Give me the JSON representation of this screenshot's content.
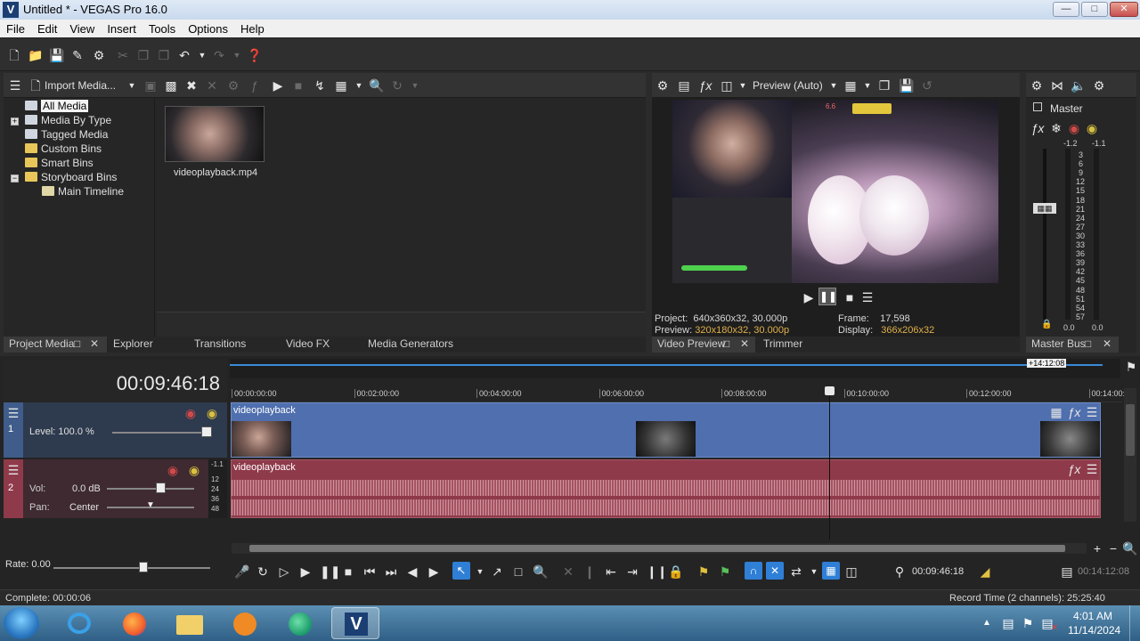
{
  "window": {
    "title": "Untitled * - VEGAS Pro 16.0",
    "app_icon_letter": "V"
  },
  "menu": [
    "File",
    "Edit",
    "View",
    "Insert",
    "Tools",
    "Options",
    "Help"
  ],
  "project_media": {
    "import_label": "Import Media...",
    "tree": [
      {
        "label": "All Media",
        "selected": true
      },
      {
        "label": "Media By Type"
      },
      {
        "label": "Tagged Media"
      },
      {
        "label": "Custom Bins"
      },
      {
        "label": "Smart Bins"
      },
      {
        "label": "Storyboard Bins"
      },
      {
        "label": "Main Timeline"
      }
    ],
    "media_file": "videoplayback.mp4"
  },
  "left_tabs": [
    "Project Media",
    "Explorer",
    "Transitions",
    "Video FX",
    "Media Generators"
  ],
  "preview": {
    "mode_label": "Preview (Auto)",
    "project_label": "Project:",
    "project_value": "640x360x32, 30.000p",
    "preview_label": "Preview:",
    "preview_value": "320x180x32, 30.000p",
    "frame_label": "Frame:",
    "frame_value": "17,598",
    "display_label": "Display:",
    "display_value": "366x206x32",
    "tabs": [
      "Video Preview",
      "Trimmer"
    ],
    "overlay_badge": "6.6"
  },
  "master": {
    "label": "Master",
    "peak_left": "-1.2",
    "peak_right": "-1.1",
    "scale": [
      "3",
      "6",
      "9",
      "12",
      "15",
      "18",
      "21",
      "24",
      "27",
      "30",
      "33",
      "36",
      "39",
      "42",
      "45",
      "48",
      "51",
      "54",
      "57"
    ],
    "bottom_left": "0.0",
    "bottom_right": "0.0",
    "tab": "Master Bus"
  },
  "timeline": {
    "timecode": "00:09:46:18",
    "loop_end": "+14:12:08",
    "ruler": [
      "00:00:00:00",
      "00:02:00:00",
      "00:04:00:00",
      "00:06:00:00",
      "00:08:00:00",
      "00:10:00:00",
      "00:12:00:00",
      "00:14:00:00"
    ],
    "video_track": {
      "number": "1",
      "level_label": "Level: 100.0 %",
      "event_name": "videoplayback"
    },
    "audio_track": {
      "number": "2",
      "vol_label": "Vol:",
      "vol_value": "0.0 dB",
      "pan_label": "Pan:",
      "pan_value": "Center",
      "meter_top": "-1.1",
      "meter_scale": [
        "12",
        "24",
        "36",
        "48"
      ],
      "event_name": "videoplayback"
    },
    "rate_label": "Rate: 0.00",
    "transport_time": "00:09:46:18",
    "end_time": "00:14:12:08"
  },
  "status": {
    "complete": "Complete: 00:00:06",
    "record_time": "Record Time (2 channels): 25:25:40"
  },
  "taskbar": {
    "time": "4:01 AM",
    "date": "11/14/2024"
  },
  "colors": {
    "video_event": "#4f6fae",
    "audio_event": "#8f3a4a",
    "accent": "#2f7fd6"
  }
}
